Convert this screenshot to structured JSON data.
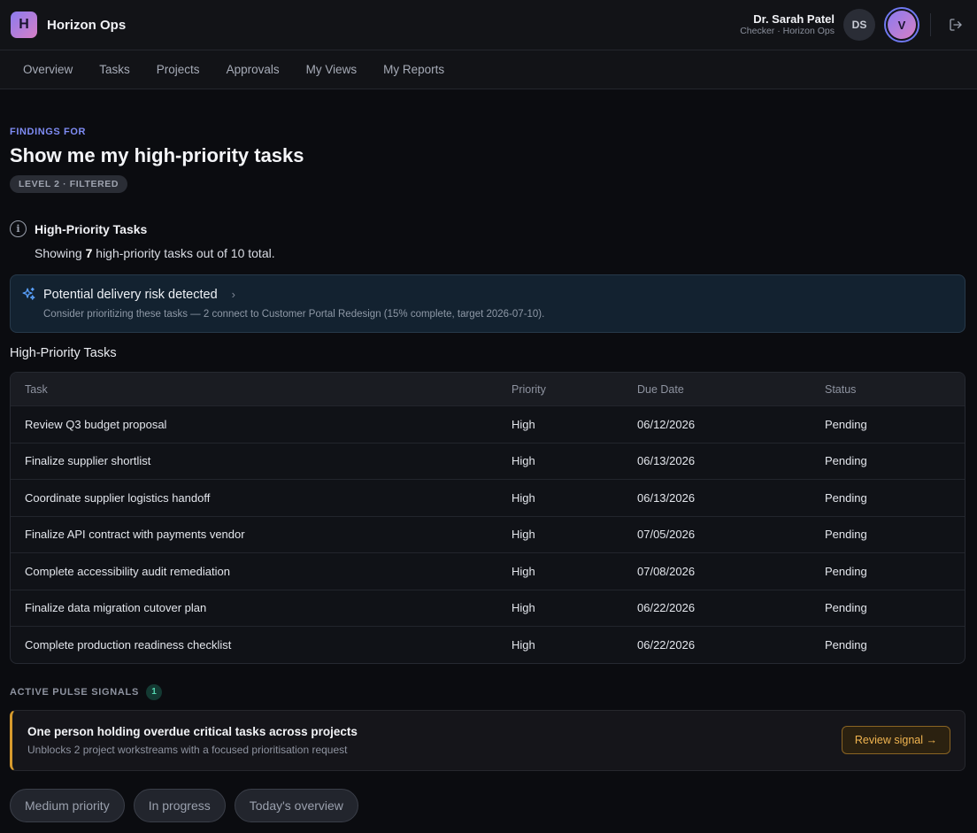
{
  "header": {
    "brand_initial": "H",
    "brand_name": "Horizon Ops",
    "user_name": "Dr. Sarah Patel",
    "user_role": "Checker · Horizon Ops",
    "avatar_initials": "DS",
    "active_avatar": "V"
  },
  "nav": {
    "items": [
      {
        "label": "Overview"
      },
      {
        "label": "Tasks"
      },
      {
        "label": "Projects"
      },
      {
        "label": "Approvals"
      },
      {
        "label": "My Views"
      },
      {
        "label": "My Reports"
      }
    ]
  },
  "page": {
    "eyebrow": "FINDINGS FOR",
    "title": "Show me my high-priority tasks",
    "level_badge": "LEVEL 2 · FILTERED"
  },
  "summary": {
    "title": "High-Priority Tasks",
    "prefix": "Showing ",
    "count": "7",
    "suffix": " high-priority tasks out of 10 total."
  },
  "risk": {
    "title": "Potential delivery risk detected",
    "subtitle": "Consider prioritizing these tasks — 2 connect to Customer Portal Redesign (15% complete, target 2026-07-10)."
  },
  "table": {
    "title": "High-Priority Tasks",
    "columns": [
      "Task",
      "Priority",
      "Due Date",
      "Status"
    ],
    "rows": [
      [
        "Review Q3 budget proposal",
        "High",
        "06/12/2026",
        "Pending"
      ],
      [
        "Finalize supplier shortlist",
        "High",
        "06/13/2026",
        "Pending"
      ],
      [
        "Coordinate supplier logistics handoff",
        "High",
        "06/13/2026",
        "Pending"
      ],
      [
        "Finalize API contract with payments vendor",
        "High",
        "07/05/2026",
        "Pending"
      ],
      [
        "Complete accessibility audit remediation",
        "High",
        "07/08/2026",
        "Pending"
      ],
      [
        "Finalize data migration cutover plan",
        "High",
        "06/22/2026",
        "Pending"
      ],
      [
        "Complete production readiness checklist",
        "High",
        "06/22/2026",
        "Pending"
      ]
    ]
  },
  "signals": {
    "label": "ACTIVE PULSE SIGNALS",
    "count": "1",
    "card": {
      "title": "One person holding overdue critical tasks across projects",
      "subtitle": "Unblocks 2 project workstreams with a focused prioritisation request",
      "button": "Review signal →"
    }
  },
  "chips": [
    {
      "label": "Medium priority"
    },
    {
      "label": "In progress"
    },
    {
      "label": "Today's overview"
    }
  ]
}
